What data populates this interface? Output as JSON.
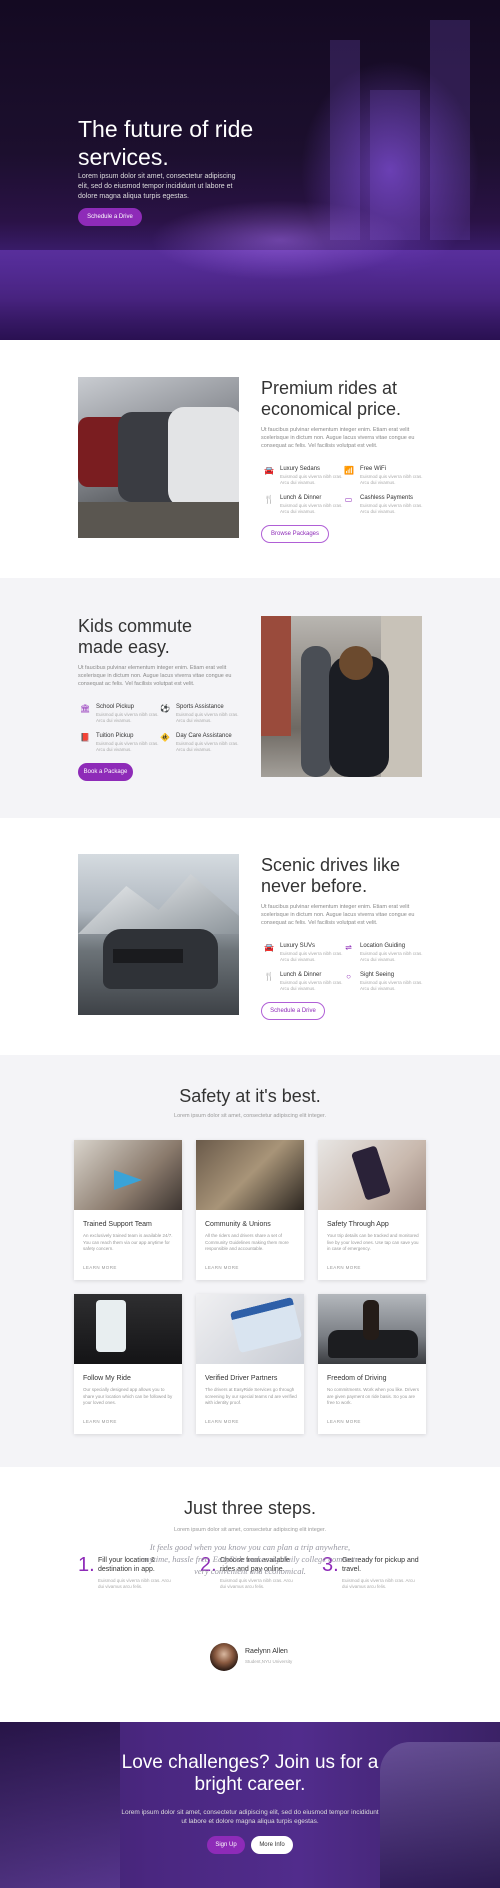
{
  "hero": {
    "title": "The future of ride services.",
    "body": "Lorem ipsum dolor sit amet, consectetur adipiscing elit, sed do eiusmod tempor incididunt ut labore et dolore magna aliqua turpis egestas.",
    "button": "Schedule a Drive"
  },
  "premium": {
    "title": "Premium rides at economical price.",
    "body": "Ut faucibus pulvinar elementum integer enim. Etiam erat velit scelerisque in dictum non. Augue lacus viverra vitae congue eu consequat ac felis. Vel facilisis volutpat est velit.",
    "features": [
      {
        "icon": "car-icon",
        "title": "Luxury Sedans",
        "desc": "Euismod quis viverra nibh cras. Arcu dui vivamus."
      },
      {
        "icon": "wifi-icon",
        "title": "Free WiFi",
        "desc": "Euismod quis viverra nibh cras. Arcu dui vivamus."
      },
      {
        "icon": "utensils-icon",
        "title": "Lunch & Dinner",
        "desc": "Euismod quis viverra nibh cras. Arcu dui vivamus."
      },
      {
        "icon": "credit-card-icon",
        "title": "Cashless Payments",
        "desc": "Euismod quis viverra nibh cras. Arcu dui vivamus."
      }
    ],
    "button": "Browse Packages"
  },
  "kids": {
    "title": "Kids commute made easy.",
    "body": "Ut faucibus pulvinar elementum integer enim. Etiam erat velit scelerisque in dictum non. Augue lacus viverra vitae congue eu consequat ac felis. Vel facilisis volutpat est velit.",
    "features": [
      {
        "icon": "school-icon",
        "title": "School Pickup",
        "desc": "Euismod quis viverra nibh cras. Arcu dui vivamus."
      },
      {
        "icon": "soccer-ball-icon",
        "title": "Sports Assistance",
        "desc": "Euismod quis viverra nibh cras. Arcu dui vivamus."
      },
      {
        "icon": "book-icon",
        "title": "Tuition Pickup",
        "desc": "Euismod quis viverra nibh cras. Arcu dui vivamus."
      },
      {
        "icon": "child-icon",
        "title": "Day Care Assistance",
        "desc": "Euismod quis viverra nibh cras. Arcu dui vivamus."
      }
    ],
    "button": "Book a Package"
  },
  "scenic": {
    "title": "Scenic drives like never before.",
    "body": "Ut faucibus pulvinar elementum integer enim. Etiam erat velit scelerisque in dictum non. Augue lacus viverra vitae congue eu consequat ac felis. Vel facilisis volutpat est velit.",
    "features": [
      {
        "icon": "car-icon",
        "title": "Luxury SUVs",
        "desc": "Euismod quis viverra nibh cras. Arcu dui vivamus."
      },
      {
        "icon": "signpost-icon",
        "title": "Location Guiding",
        "desc": "Euismod quis viverra nibh cras. Arcu dui vivamus."
      },
      {
        "icon": "utensils-icon",
        "title": "Lunch & Dinner",
        "desc": "Euismod quis viverra nibh cras. Arcu dui vivamus."
      },
      {
        "icon": "circle-icon",
        "title": "Sight Seeing",
        "desc": "Euismod quis viverra nibh cras. Arcu dui vivamus."
      }
    ],
    "button": "Schedule a Drive"
  },
  "safety": {
    "title": "Safety at it's best.",
    "subtitle": "Lorem ipsum dolor sit amet, consectetur adipiscing elit integer.",
    "cards": [
      {
        "title": "Trained Support Team",
        "desc": "An exclusively trained team is available 24/7. You can reach them via our app anytime for safety concern.",
        "link": "LEARN MORE"
      },
      {
        "title": "Community & Unions",
        "desc": "All the riders and drivers share a set of Community Guidelines making them more responsible and accountable.",
        "link": "LEARN MORE"
      },
      {
        "title": "Safety Through App",
        "desc": "Your trip details can be tracked and monitored live by your loved ones. Use tap can save you in case of emergency.",
        "link": "LEARN MORE"
      },
      {
        "title": "Follow My Ride",
        "desc": "Our specially designed app allows you to share your location which can be followed by your loved ones.",
        "link": "LEARN MORE"
      },
      {
        "title": "Verified Driver Partners",
        "desc": "The drivers at EasyRide Services go through screening by our special teams nd are verified with identity proof.",
        "link": "LEARN MORE"
      },
      {
        "title": "Freedom of Driving",
        "desc": "No commitments. Work when you like. Drivers are given payment on ride basis. So you are free to work.",
        "link": "LEARN MORE"
      }
    ]
  },
  "steps": {
    "title": "Just three steps.",
    "subtitle": "Lorem ipsum dolor sit amet, consectetur adipiscing elit integer.",
    "items": [
      {
        "num": "1.",
        "title": "Fill your location & destination in app.",
        "desc": "Euismod quis viverra nibh cras. Arcu dui vivamus arcu felis."
      },
      {
        "num": "2.",
        "title": "Choose from available rides and pay online.",
        "desc": "Euismod quis viverra nibh cras. Arcu dui vivamus arcu felis."
      },
      {
        "num": "3.",
        "title": "Get ready for pickup and travel.",
        "desc": "Euismod quis viverra nibh cras. Arcu dui vivamus arcu felis."
      }
    ],
    "quote": "It feels good when you know you can plan a trip anywhere, anytime, hassle free. EazyRide makes my daily college commute very convenient and economical.",
    "author": "Raelynn Allen",
    "author_role": "Student,NYU University"
  },
  "cta": {
    "title": "Love challenges? Join us for a bright career.",
    "body": "Lorem ipsum dolor sit amet, consectetur adipiscing elit, sed do eiusmod tempor incididunt ut labore et dolore magna aliqua turpis egestas.",
    "primary": "Sign Up",
    "secondary": "More Info"
  },
  "colors": {
    "accent": "#8e2bb8",
    "grey_section": "#f4f4f7"
  }
}
